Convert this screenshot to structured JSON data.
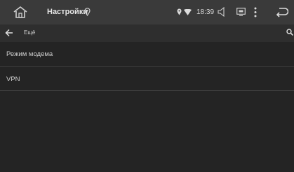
{
  "status_bar": {
    "title": "Настройки",
    "time": "18:39"
  },
  "action_bar": {
    "title": "Ещё"
  },
  "list": {
    "items": [
      {
        "label": "Режим модема"
      },
      {
        "label": "VPN"
      }
    ]
  },
  "icons": {
    "home": "home-icon",
    "location": "location-pin-icon",
    "wifi": "wifi-icon",
    "volume": "volume-icon",
    "screen": "screen-icon",
    "menu": "more-vertical-icon",
    "system_back": "system-back-icon",
    "back": "back-arrow-icon",
    "search": "search-icon"
  },
  "colors": {
    "status_bar": "#3a3a3a",
    "action_bar": "#2e2e2e",
    "background": "#242424",
    "text": "#cfcfcf",
    "divider": "#3d3d3d"
  }
}
